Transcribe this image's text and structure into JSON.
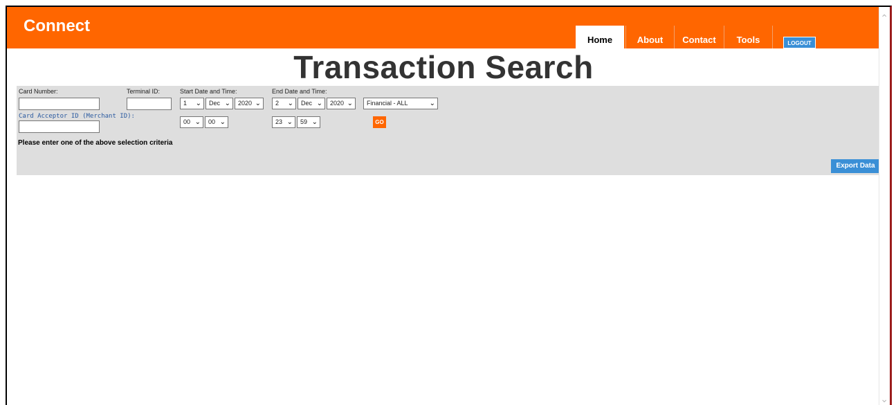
{
  "header": {
    "brand": "Connect",
    "nav": [
      {
        "label": "Home",
        "active": true
      },
      {
        "label": "About"
      },
      {
        "label": "Contact"
      },
      {
        "label": "Tools"
      }
    ],
    "logout": "LOGOUT",
    "accent_color": "#ff6600"
  },
  "page": {
    "title": "Transaction Search"
  },
  "form": {
    "card_number_label": "Card Number:",
    "card_number_value": "",
    "terminal_id_label": "Terminal ID:",
    "terminal_id_value": "",
    "card_acceptor_label": "Card Acceptor ID (Merchant ID):",
    "card_acceptor_value": "",
    "start_label": "Start Date and Time:",
    "start_day": "1",
    "start_month": "Dec",
    "start_year": "2020",
    "start_hour": "00",
    "start_minute": "00",
    "end_label": "End Date and Time:",
    "end_day": "2",
    "end_month": "Dec",
    "end_year": "2020",
    "end_hour": "23",
    "end_minute": "59",
    "type_selected": "Financial - ALL",
    "go_label": "GO",
    "message": "Please enter one of the above selection criteria",
    "export_label": "Export Data"
  },
  "icons": {
    "dropdown": "chevron-down-icon",
    "scroll_up": "chevron-up-icon",
    "scroll_down": "chevron-down-icon"
  }
}
